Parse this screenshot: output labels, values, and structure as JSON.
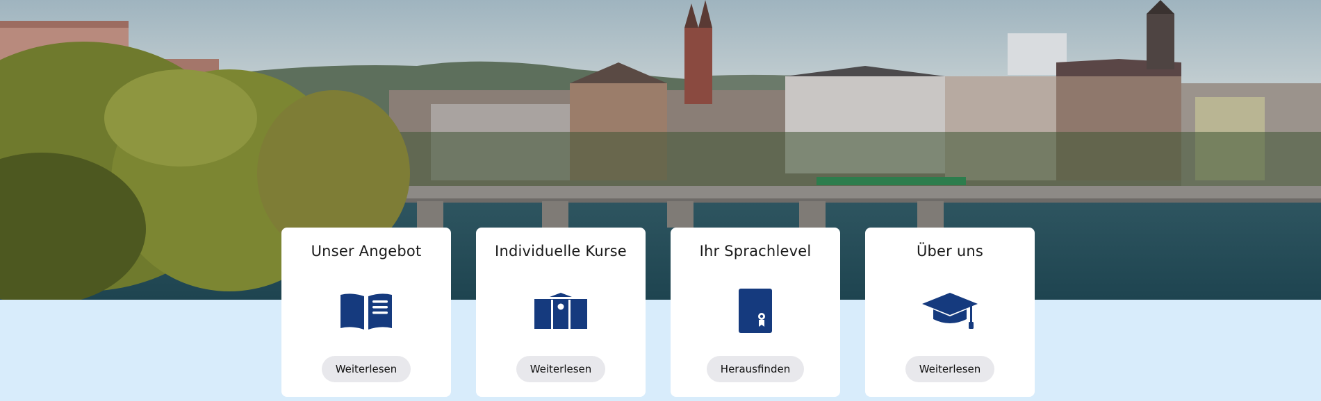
{
  "cards": [
    {
      "title": "Unser Angebot",
      "button": "Weiterlesen",
      "icon": "open-book-icon"
    },
    {
      "title": "Individuelle Kurse",
      "button": "Weiterlesen",
      "icon": "classroom-building-icon"
    },
    {
      "title": "Ihr Sprachlevel",
      "button": "Herausfinden",
      "icon": "certificate-icon"
    },
    {
      "title": "Über uns",
      "button": "Weiterlesen",
      "icon": "graduation-cap-icon"
    }
  ],
  "colors": {
    "icon": "#153a7e",
    "band": "#d8ecfb",
    "button_bg": "#e8e8ec",
    "card_bg": "#ffffff"
  }
}
